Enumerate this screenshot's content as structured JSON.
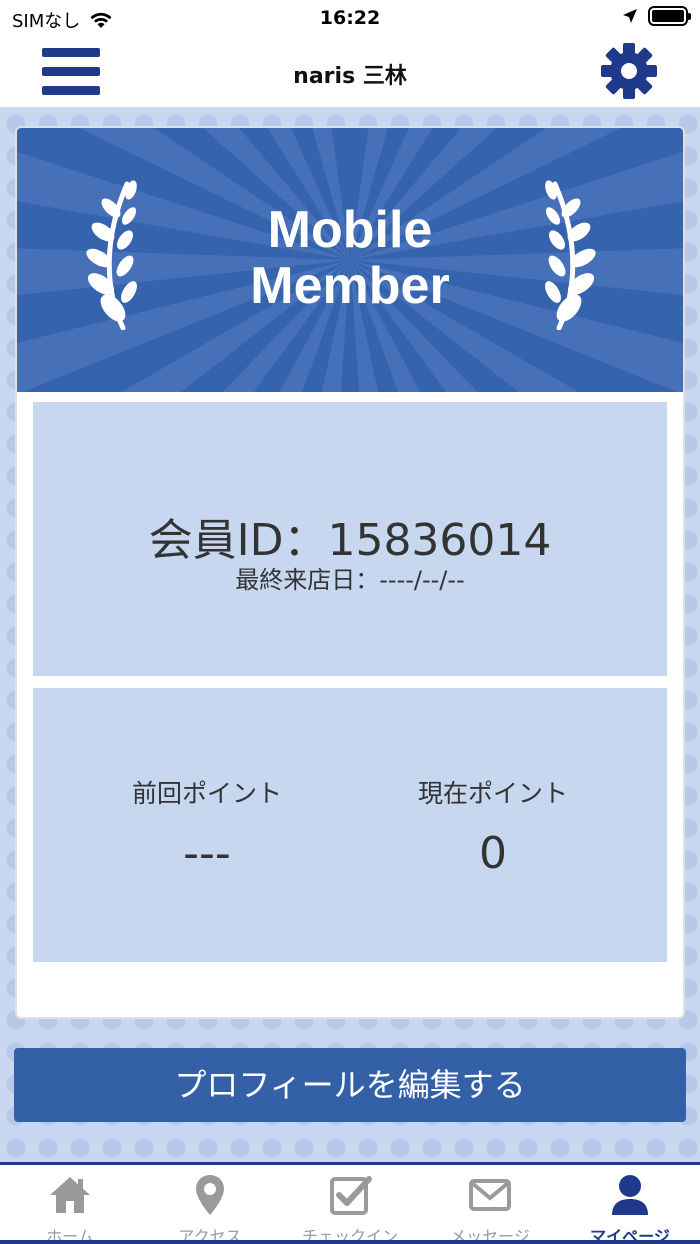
{
  "status_bar": {
    "carrier": "SIMなし",
    "time": "16:22"
  },
  "header": {
    "title": "naris 三林"
  },
  "card": {
    "banner_line1": "Mobile",
    "banner_line2": "Member",
    "member_id_text": "会員ID：15836014",
    "last_visit_text": "最終来店日：----/--/--",
    "previous_points_label": "前回ポイント",
    "previous_points_value": "---",
    "current_points_label": "現在ポイント",
    "current_points_value": "0"
  },
  "edit_profile_label": "プロフィールを編集する",
  "tabs": [
    {
      "label": "ホーム",
      "icon": "home-icon"
    },
    {
      "label": "アクセス",
      "icon": "map-pin-icon"
    },
    {
      "label": "チェックイン",
      "icon": "checkin-icon"
    },
    {
      "label": "メッセージ",
      "icon": "envelope-icon"
    },
    {
      "label": "マイページ",
      "icon": "user-icon"
    }
  ],
  "colors": {
    "accent": "#1f3a8a",
    "button": "#3460a8",
    "panel": "#c7d7f0"
  }
}
